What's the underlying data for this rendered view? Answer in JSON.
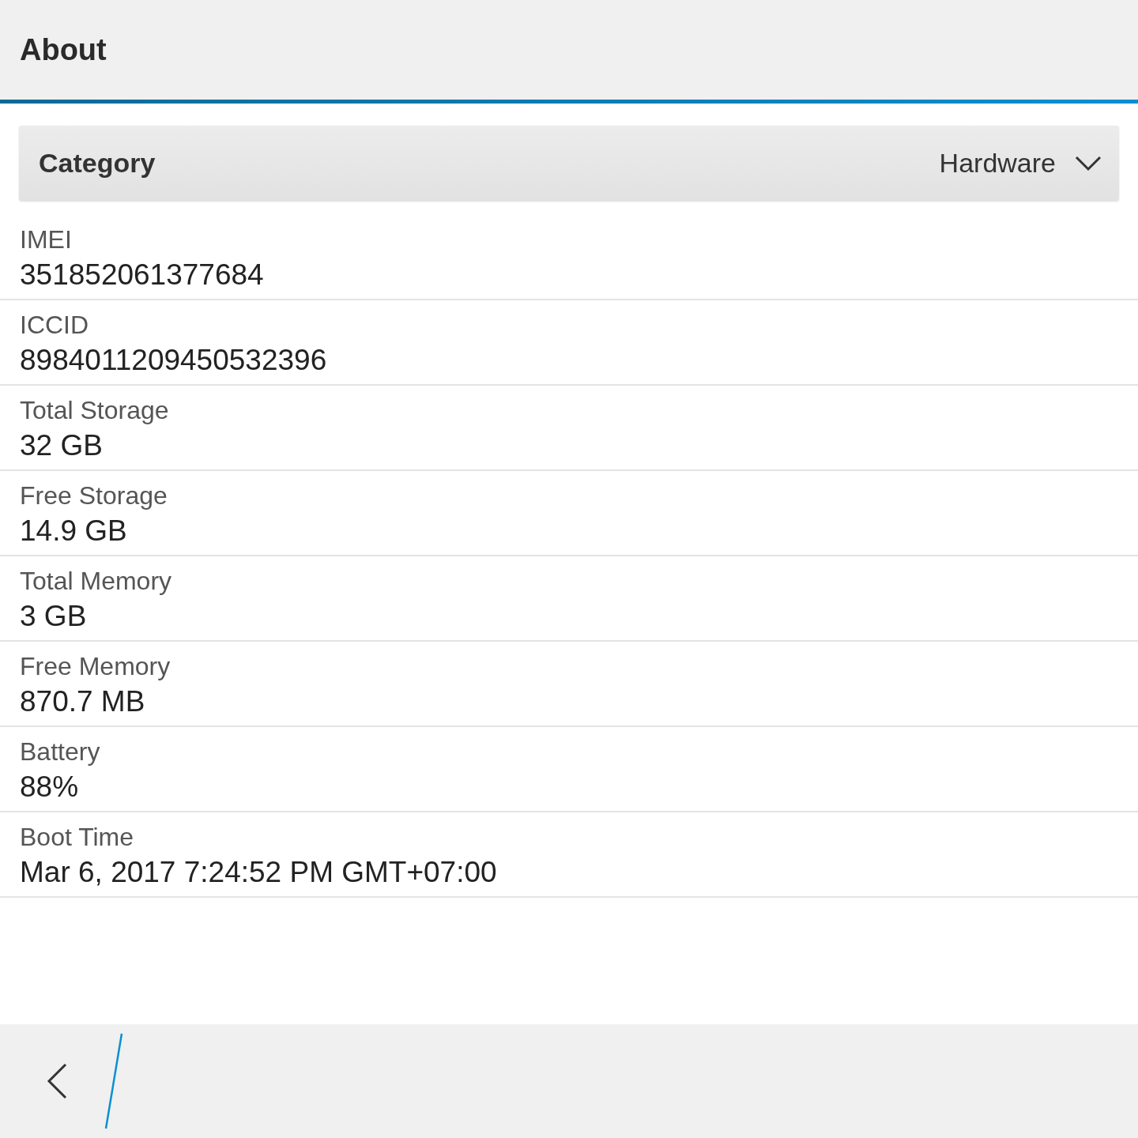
{
  "header": {
    "title": "About"
  },
  "category": {
    "label": "Category",
    "value": "Hardware"
  },
  "rows": [
    {
      "label": "IMEI",
      "value": "351852061377684"
    },
    {
      "label": "ICCID",
      "value": "8984011209450532396"
    },
    {
      "label": "Total Storage",
      "value": "32 GB"
    },
    {
      "label": "Free Storage",
      "value": "14.9 GB"
    },
    {
      "label": "Total Memory",
      "value": "3 GB"
    },
    {
      "label": "Free Memory",
      "value": "870.7 MB"
    },
    {
      "label": "Battery",
      "value": "88%"
    },
    {
      "label": "Boot Time",
      "value": "Mar 6, 2017 7:24:52 PM GMT+07:00"
    }
  ]
}
